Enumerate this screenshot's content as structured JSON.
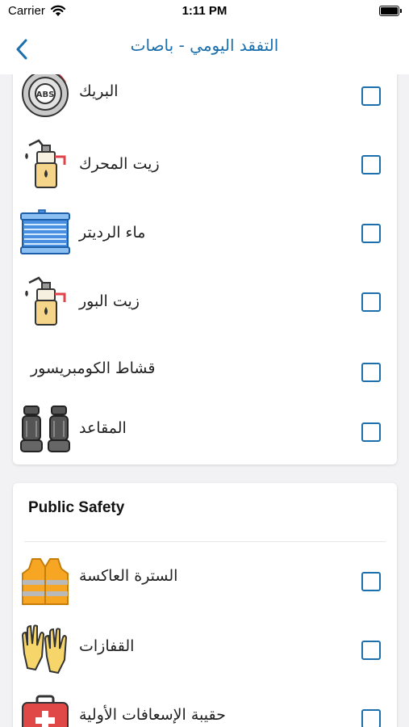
{
  "status": {
    "carrier": "Carrier",
    "time": "1:11 PM"
  },
  "nav": {
    "title": "التفقد اليومي - باصات"
  },
  "vehicle_items": [
    {
      "label": "البريك",
      "icon": "abs-brake-icon"
    },
    {
      "label": "زيت المحرك",
      "icon": "oil-can-icon"
    },
    {
      "label": "ماء الرديتر",
      "icon": "radiator-icon"
    },
    {
      "label": "زيت البور",
      "icon": "oil-can-icon"
    },
    {
      "label": "قشاط الكومبريسور",
      "icon": ""
    },
    {
      "label": "المقاعد",
      "icon": "car-seats-icon"
    }
  ],
  "public_safety": {
    "title": "Public Safety",
    "items": [
      {
        "label": "السترة العاكسة",
        "icon": "safety-vest-icon"
      },
      {
        "label": "القفازات",
        "icon": "gloves-icon"
      },
      {
        "label": "حقيبة الإسعافات الأولية",
        "icon": "first-aid-kit-icon"
      }
    ]
  },
  "colors": {
    "accent": "#1b6fad",
    "background": "#f2f2f4"
  }
}
